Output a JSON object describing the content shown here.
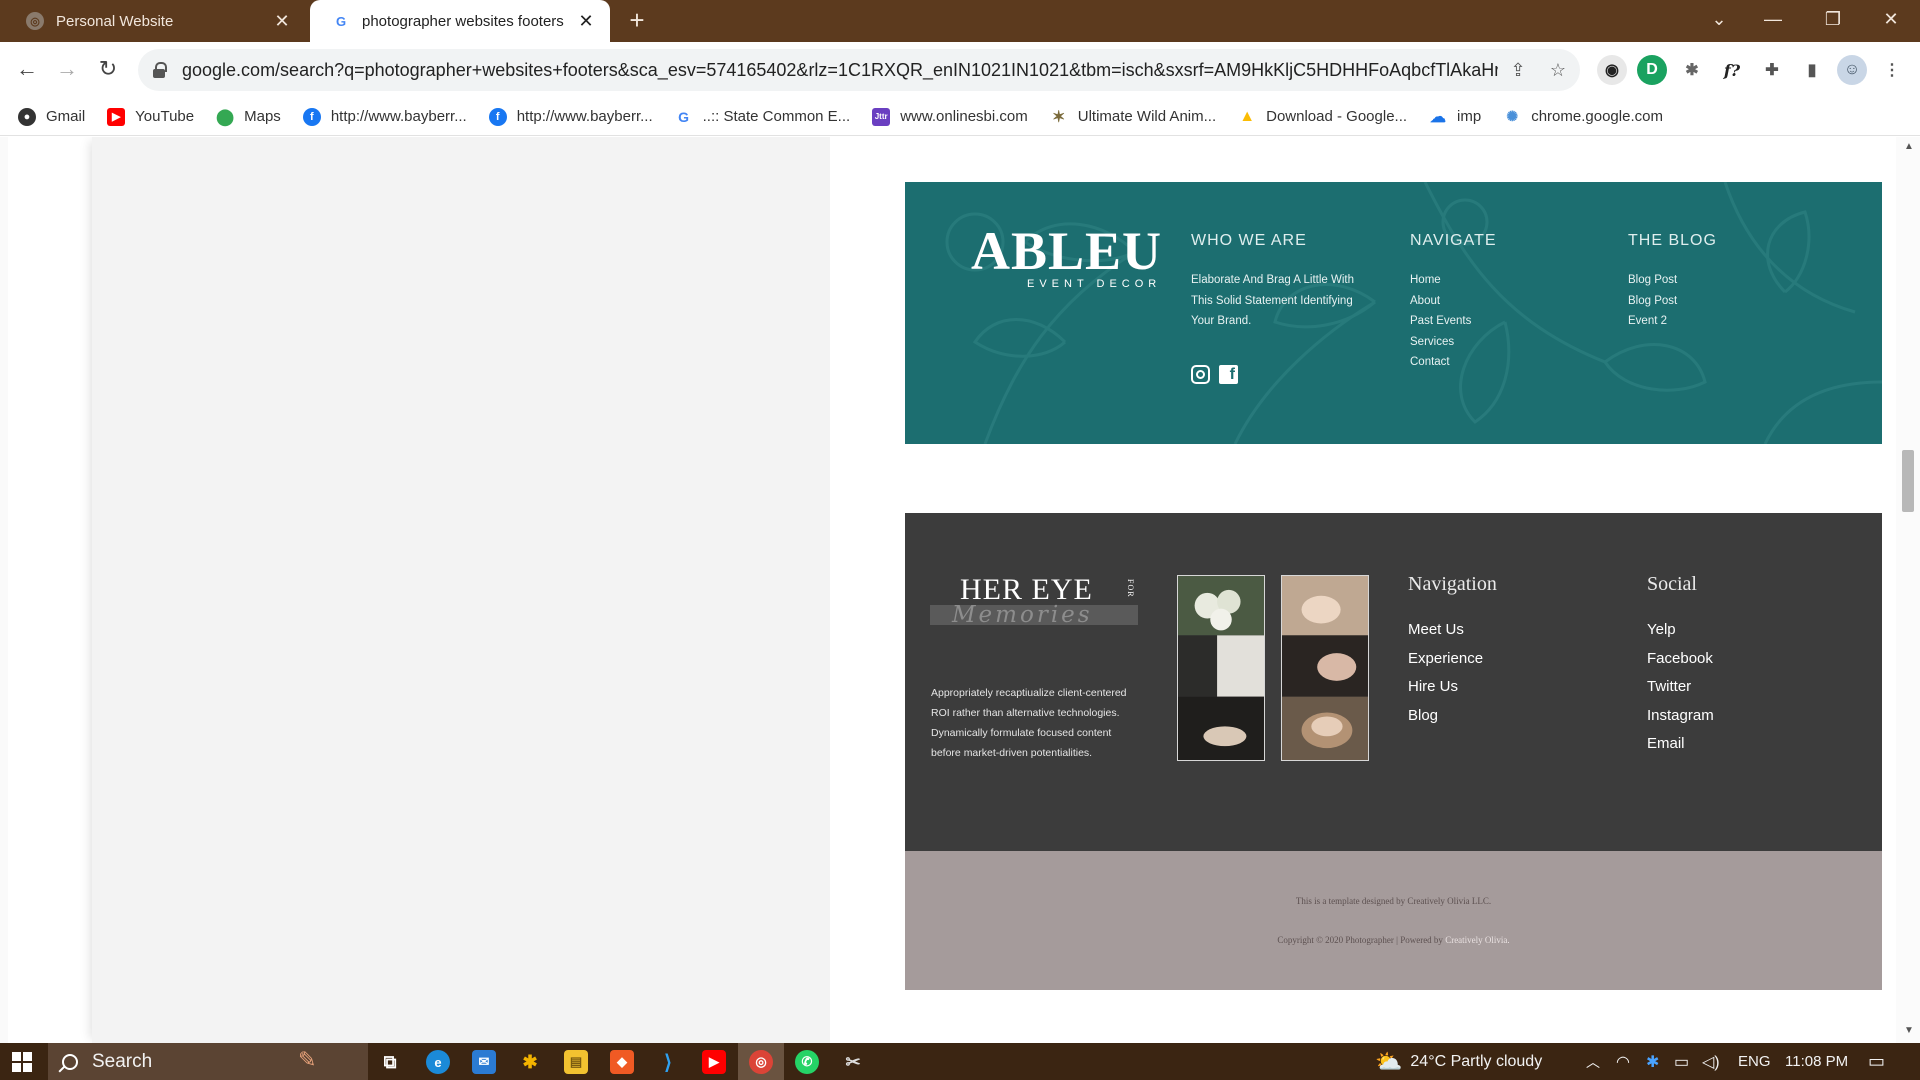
{
  "browser": {
    "tabs": [
      {
        "title": "Personal Website",
        "active": false
      },
      {
        "title": "photographer websites footers",
        "active": true
      }
    ],
    "new_tab_label": "+",
    "url": "google.com/search?q=photographer+websites+footers&sca_esv=574165402&rlz=1C1RXQR_enIN1021IN1021&tbm=isch&sxsrf=AM9HkKljC5HDHHFoAqbcfTlAkaHr5uy...",
    "bookmarks": [
      {
        "label": "Gmail",
        "icon": "github-icon",
        "color": "#333333"
      },
      {
        "label": "YouTube",
        "icon": "youtube-icon",
        "color": "#ff0000"
      },
      {
        "label": "Maps",
        "icon": "maps-icon",
        "color": "#34a853"
      },
      {
        "label": "http://www.bayberr...",
        "icon": "facebook-icon",
        "color": "#1877f2"
      },
      {
        "label": "http://www.bayberr...",
        "icon": "facebook-icon",
        "color": "#1877f2"
      },
      {
        "label": "..:: State Common E...",
        "icon": "google-icon",
        "color": "#4285f4"
      },
      {
        "label": "www.onlinesbi.com",
        "icon": "sbi-icon",
        "color": "#6a3fc1"
      },
      {
        "label": "Ultimate Wild Anim...",
        "icon": "animal-icon",
        "color": "#7a6a3a"
      },
      {
        "label": "Download - Google...",
        "icon": "drive-icon",
        "color": "#fbbc04"
      },
      {
        "label": "imp",
        "icon": "cloud-icon",
        "color": "#1a73e8"
      },
      {
        "label": "chrome.google.com",
        "icon": "chrome-web-icon",
        "color": "#4a90d9"
      }
    ]
  },
  "footer_ableu": {
    "logo_word": "ABLEU",
    "logo_sub": "EVENT DECOR",
    "who_heading": "WHO WE ARE",
    "who_text": "Elaborate And Brag A Little With This Solid Statement Identifying Your Brand.",
    "navigate_heading": "NAVIGATE",
    "navigate_links": [
      "Home",
      "About",
      "Past Events",
      "Services",
      "Contact"
    ],
    "blog_heading": "THE BLOG",
    "blog_links": [
      "Blog Post",
      "Blog Post",
      "Event 2"
    ],
    "bg_color": "#1c6e70"
  },
  "footer_hereye": {
    "logo_title": "HER EYE",
    "logo_for": "FOR",
    "logo_script": "Memories",
    "description": "Appropriately recaptiualize client-centered ROI rather than alternative technologies. Dynamically formulate focused content before market-driven potentialities.",
    "navigation_heading": "Navigation",
    "navigation_links": [
      "Meet Us",
      "Experience",
      "Hire Us",
      "Blog"
    ],
    "social_heading": "Social",
    "social_links": [
      "Yelp",
      "Facebook",
      "Twitter",
      "Instagram",
      "Email"
    ],
    "copyright_line1": "This is a template designed by Creatively Olivia LLC.",
    "copyright_line2_prefix": "Copyright © 2020 Photographer | Powered by ",
    "copyright_line2_link": "Creatively Olivia.",
    "bg_color": "#3c3c3c",
    "bar_color": "#a59b9b"
  },
  "taskbar": {
    "search_label": "Search",
    "weather": "24°C  Partly cloudy",
    "language": "ENG",
    "time": "11:08 PM"
  }
}
